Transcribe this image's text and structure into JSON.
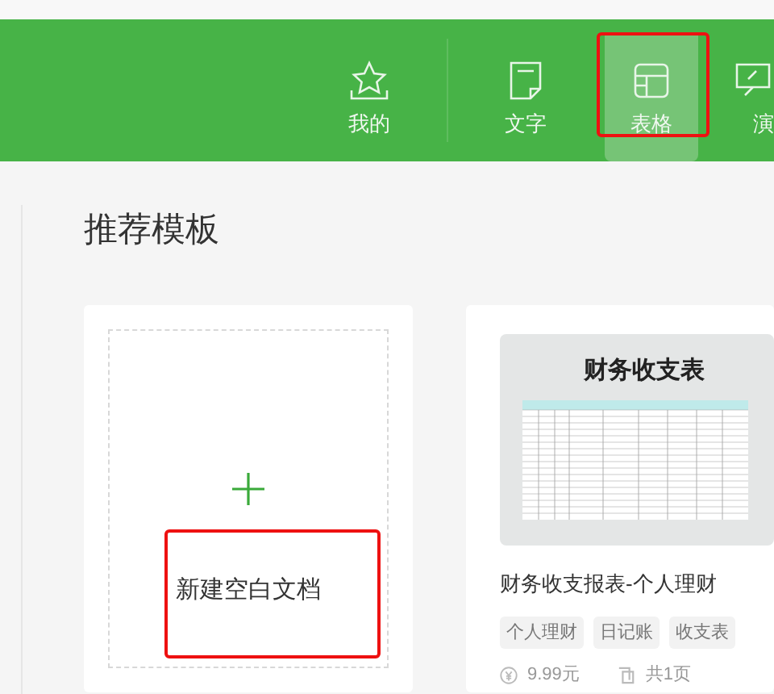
{
  "nav_tabs": [
    {
      "label": "我的",
      "kind": "star",
      "selected": false
    },
    {
      "label": "文字",
      "kind": "note",
      "selected": false
    },
    {
      "label": "表格",
      "kind": "table",
      "selected": true
    },
    {
      "label": "演",
      "kind": "slide",
      "selected": false
    }
  ],
  "section_title": "推荐模板",
  "new_blank": {
    "label": "新建空白文档"
  },
  "template": {
    "thumbnail_title": "财务收支表",
    "title": "财务收支报表-个人理财",
    "tags": [
      "个人理财",
      "日记账",
      "收支表"
    ],
    "price": "9.99元",
    "pages": "共1页"
  }
}
